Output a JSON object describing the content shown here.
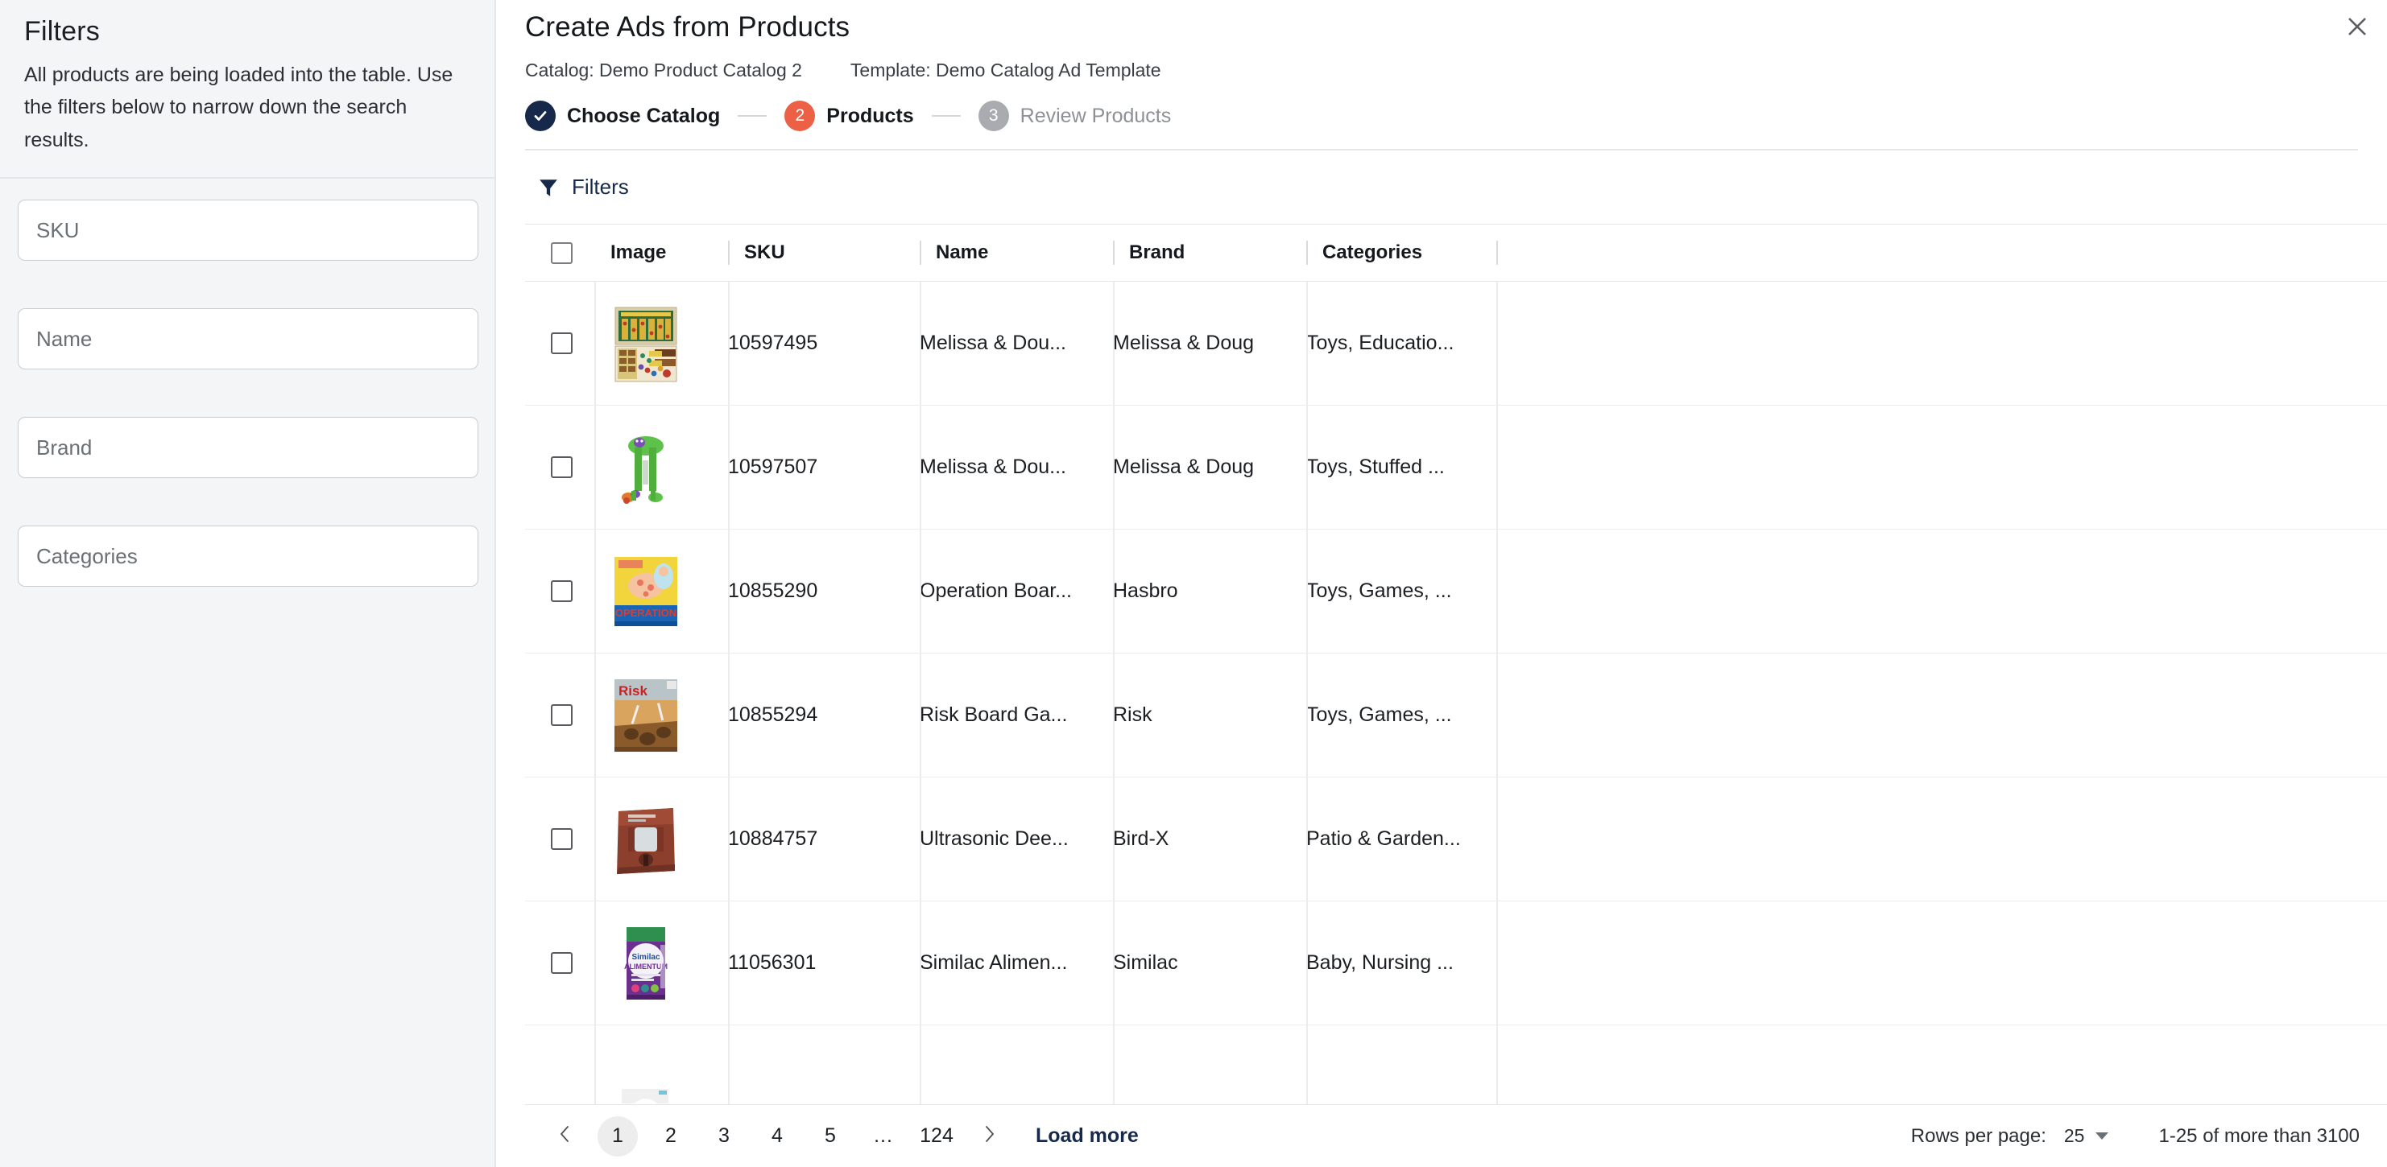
{
  "sidebar": {
    "title": "Filters",
    "description": "All products are being loaded into the table. Use the filters below to narrow down the search results.",
    "fields": [
      {
        "name": "sku",
        "placeholder": "SKU",
        "value": ""
      },
      {
        "name": "name",
        "placeholder": "Name",
        "value": ""
      },
      {
        "name": "brand",
        "placeholder": "Brand",
        "value": ""
      },
      {
        "name": "categories",
        "placeholder": "Categories",
        "value": ""
      }
    ]
  },
  "header": {
    "title": "Create Ads from Products",
    "catalog": "Catalog: Demo Product Catalog 2",
    "template": "Template: Demo Catalog Ad Template",
    "close_icon": "close-icon"
  },
  "stepper": {
    "steps": [
      {
        "marker": "✓",
        "label": "Choose Catalog",
        "state": "done"
      },
      {
        "marker": "2",
        "label": "Products",
        "state": "active"
      },
      {
        "marker": "3",
        "label": "Review Products",
        "state": "todo"
      }
    ],
    "colors": {
      "done": "#16294a",
      "active": "#ec6045",
      "todo": "#a8abaf"
    }
  },
  "toolbar": {
    "filters_label": "Filters",
    "filters_icon": "funnel-icon",
    "accent": "#16294a"
  },
  "table": {
    "columns": [
      "Image",
      "SKU",
      "Name",
      "Brand",
      "Categories"
    ],
    "rows": [
      {
        "sku": "10597495",
        "name": "Melissa & Dou...",
        "brand": "Melissa & Doug",
        "categories": "Toys, Educatio...",
        "thumb": "melissa-doug-activity-board"
      },
      {
        "sku": "10597507",
        "name": "Melissa & Dou...",
        "brand": "Melissa & Doug",
        "categories": "Toys, Stuffed ...",
        "thumb": "melissa-doug-green-frog"
      },
      {
        "sku": "10855290",
        "name": "Operation Boar...",
        "brand": "Hasbro",
        "categories": "Toys, Games, ...",
        "thumb": "operation-board-game"
      },
      {
        "sku": "10855294",
        "name": "Risk Board Ga...",
        "brand": "Risk",
        "categories": "Toys, Games, ...",
        "thumb": "risk-board-game"
      },
      {
        "sku": "10884757",
        "name": "Ultrasonic Dee...",
        "brand": "Bird-X",
        "categories": "Patio & Garden...",
        "thumb": "ultrasonic-deer-repeller"
      },
      {
        "sku": "11056301",
        "name": "Similac Alimen...",
        "brand": "Similac",
        "categories": "Baby, Nursing ...",
        "thumb": "similac-alimentum"
      }
    ]
  },
  "pagination": {
    "prev_icon": "chevron-left-icon",
    "next_icon": "chevron-right-icon",
    "pages": [
      "1",
      "2",
      "3",
      "4",
      "5",
      "...",
      "124"
    ],
    "current_page": "1",
    "load_more_label": "Load more",
    "rows_per_page_label": "Rows per page:",
    "rows_per_page_value": "25",
    "range_label": "1-25 of more than 3100"
  }
}
